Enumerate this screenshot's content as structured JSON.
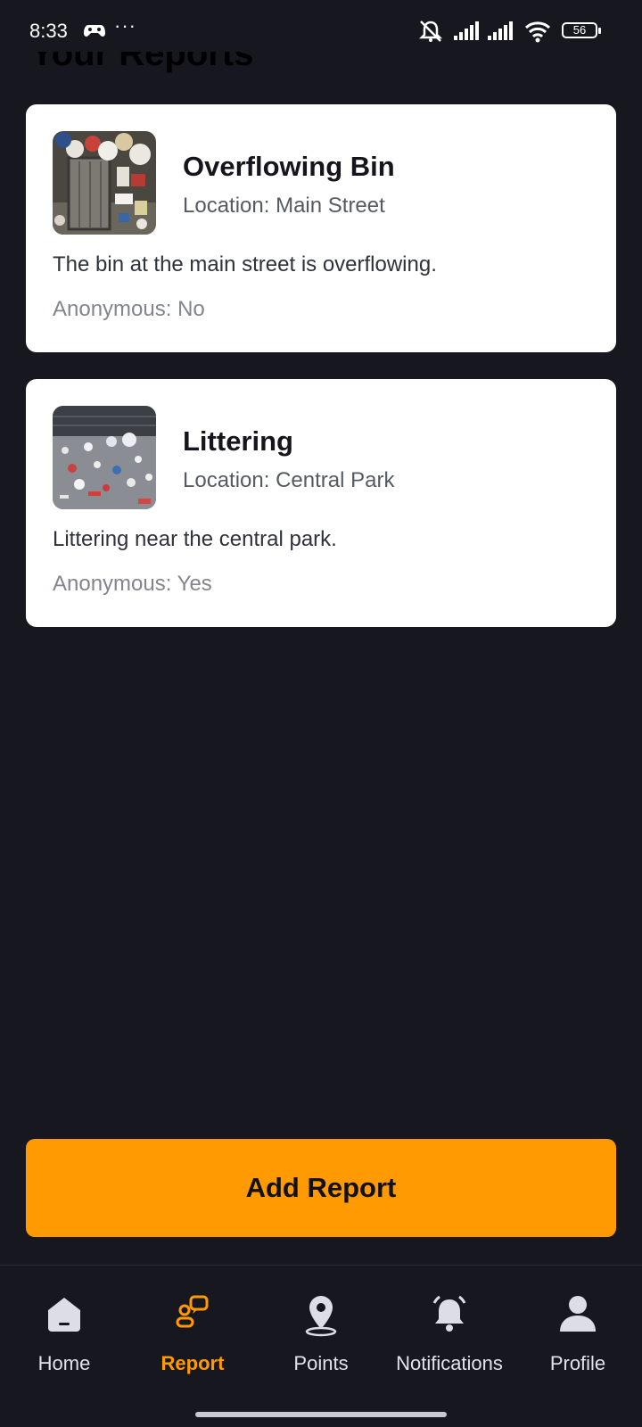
{
  "status_bar": {
    "time": "8:33",
    "more": "···",
    "battery": "56",
    "icons": [
      "game-controller-icon",
      "silent-icon",
      "signal-icon",
      "signal-icon",
      "wifi-icon",
      "battery-icon"
    ]
  },
  "page": {
    "title": "Your Reports"
  },
  "reports": [
    {
      "title": "Overflowing Bin",
      "location": "Location: Main Street",
      "description": "The bin at the main street is overflowing.",
      "anonymous": "Anonymous: No",
      "image": "overflowing-bin-photo"
    },
    {
      "title": "Littering",
      "location": "Location: Central Park",
      "description": "Littering near the central park.",
      "anonymous": "Anonymous: Yes",
      "image": "littering-photo"
    }
  ],
  "add_report_label": "Add Report",
  "nav": {
    "items": [
      {
        "label": "Home",
        "icon": "home-icon"
      },
      {
        "label": "Report",
        "icon": "report-icon",
        "active": true
      },
      {
        "label": "Points",
        "icon": "location-pin-icon"
      },
      {
        "label": "Notifications",
        "icon": "bell-icon"
      },
      {
        "label": "Profile",
        "icon": "person-icon"
      }
    ]
  },
  "colors": {
    "background": "#171720",
    "accent": "#ff9a02",
    "card": "#ffffff"
  }
}
